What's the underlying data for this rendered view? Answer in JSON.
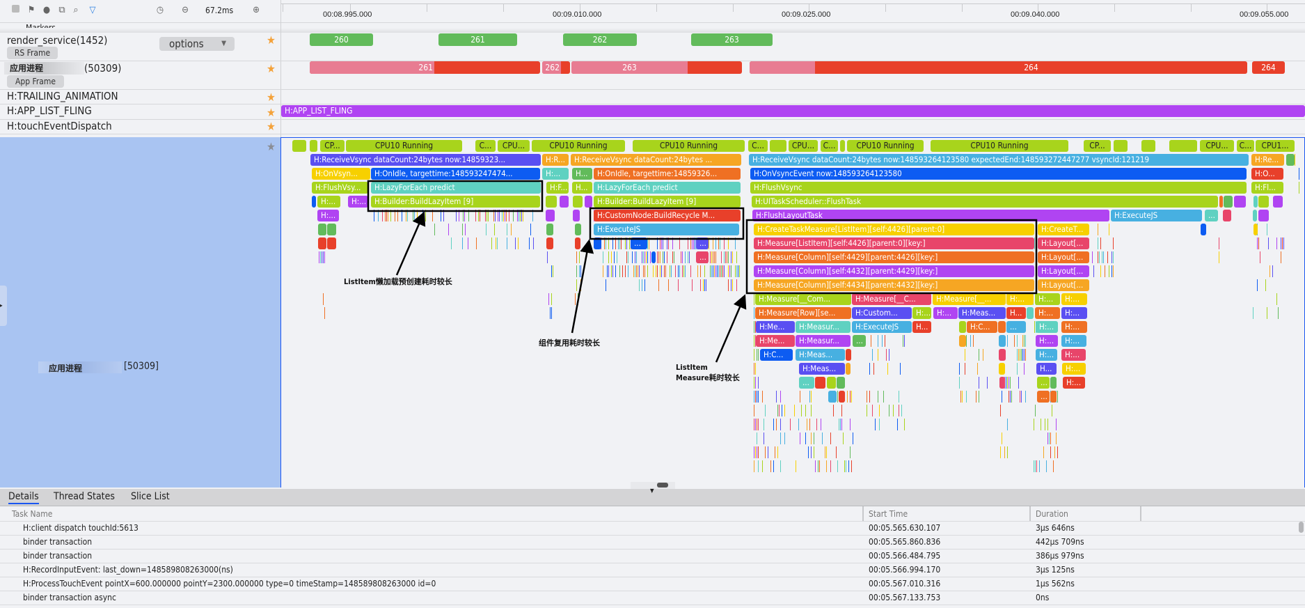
{
  "toolbar": {
    "icons": [
      "stop-icon",
      "flag-icon",
      "record-icon",
      "screenshot-icon",
      "search-icon",
      "filter-icon",
      "timer-icon",
      "zoom-out-icon",
      "zoom-in-icon"
    ],
    "zoom_value": "67.2ms",
    "markers_label": "Markers"
  },
  "timeline": {
    "ticks": [
      "00:08.995.000",
      "00:09.010.000",
      "00:09.025.000",
      "00:09.040.000",
      "00:09.055.000"
    ]
  },
  "rows": {
    "render_service": {
      "label": "render_service(1452)",
      "options_label": "options",
      "frame_label": "RS Frame"
    },
    "app": {
      "label_name": "应用进程",
      "label_pid": "(50309)",
      "frame_label": "App Frame"
    },
    "trailing": {
      "label": "H:TRAILING_ANIMATION"
    },
    "fling": {
      "label": "H:APP_LIST_FLING",
      "bar_label": "H:APP_LIST_FLING"
    },
    "touch": {
      "label": "H:touchEventDispatch"
    },
    "thread": {
      "label_name": "应用进程",
      "label_pid": "[50309]"
    }
  },
  "rs_frames": [
    "260",
    "261",
    "262",
    "263"
  ],
  "app_frames": [
    "261",
    "262",
    "263",
    "264",
    "264"
  ],
  "colors": {
    "lime": "#a8d41c",
    "teal": "#5fd1c1",
    "blue": "#0d5cf2",
    "indigo": "#5a4ff2",
    "purple": "#b044f2",
    "orange": "#ef7023",
    "amber": "#f6a623",
    "yellow": "#f7d000",
    "red": "#e8402a",
    "pink": "#e8456a",
    "lblue": "#47b0e1",
    "green": "#62bb5b",
    "rose": "#e87c92",
    "rs_green": "#62bb5b",
    "selected": "#1a56f0",
    "panel": "#a9c4f2"
  },
  "slice_labels": [
    "CP...",
    "CPU10 Running",
    "C...",
    "CPU...",
    "CPU1...",
    "H:ReceiveVsync dataCount:24bytes now:14859323...",
    "H:R...",
    "H:ReceiveVsync dataCount:24bytes ...",
    "H:ReceiveVsync dataCount:24bytes now:148593264123580 expectedEnd:148593272447277 vsyncId:121219",
    "H:Re...",
    "H:OnVsyn...",
    "H:OnIdle, targettime:148593247474...",
    "H:...",
    "H...",
    "H:OnIdle, targettime:14859326...",
    "H:OnVsyncEvent now:148593264123580",
    "H:O...",
    "H:FlushVsy...",
    "H:LazyForEach predict",
    "H:F...",
    "H:FlushVsync",
    "H:Fl...",
    "H:Builder:BuildLazyItem [9]",
    "H:UITaskScheduler::FlushTask",
    "H:CustomNode:BuildRecycle M...",
    "H:FlushLayoutTask",
    "H:ExecuteJS",
    "...",
    "H:CreateTaskMeasure[ListItem][self:4426][parent:0]",
    "H:CreateT...",
    "H:Measure[ListItem][self:4426][parent:0][key:]",
    "H:Layout[...",
    "H:Measure[Column][self:4429][parent:4426][key:]",
    "H:Measure[Column][self:4432][parent:4429][key:]",
    "H:Measure[Column][self:4434][parent:4432][key:]",
    "H:Measure[__Com...",
    "H:Measure[__C...",
    "H:Measure[__...",
    "H:Measure[Row][se...",
    "H:Custom...",
    "H:Meas...",
    "H:Me...",
    "H:Measur...",
    "H:C..."
  ],
  "annotations": {
    "lazy": "ListItem懒加载预创建耗时较长",
    "reuse": "组件复用耗时较长",
    "measure_line1": "ListItem",
    "measure_line2": "Measure耗时较长"
  },
  "details": {
    "tabs": [
      "Details",
      "Thread States",
      "Slice List"
    ],
    "active_tab": "Details",
    "columns": [
      "Task Name",
      "Start Time",
      "Duration"
    ],
    "rows": [
      {
        "name": "H:client dispatch touchId:5613",
        "start": "00:05.565.630.107",
        "duration": "3μs 646ns"
      },
      {
        "name": "binder transaction",
        "start": "00:05.565.860.836",
        "duration": "442μs 709ns"
      },
      {
        "name": "binder transaction",
        "start": "00:05.566.484.795",
        "duration": "386μs 979ns"
      },
      {
        "name": "H:RecordInputEvent: last_down=148589808263000(ns)",
        "start": "00:05.566.994.170",
        "duration": "3μs 125ns"
      },
      {
        "name": "H:ProcessTouchEvent pointX=600.000000 pointY=2300.000000 type=0 timeStamp=148589808263000 id=0",
        "start": "00:05.567.010.316",
        "duration": "1μs 562ns"
      },
      {
        "name": "binder transaction async",
        "start": "00:05.567.133.753",
        "duration": "0ns"
      }
    ]
  }
}
